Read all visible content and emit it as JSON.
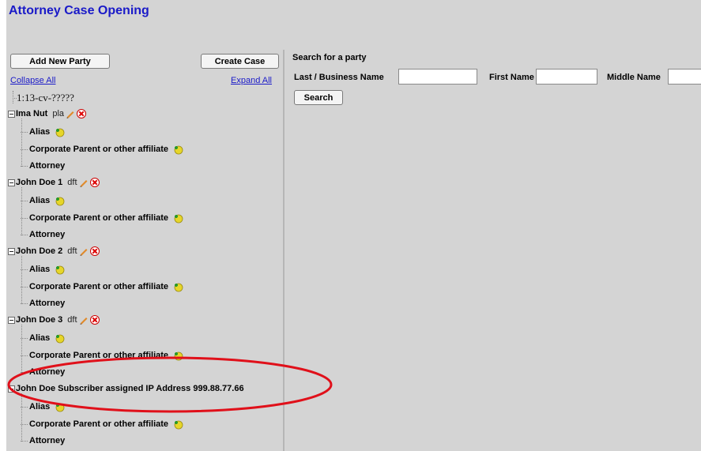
{
  "page": {
    "title": "Attorney Case Opening"
  },
  "toolbar": {
    "add_party_label": "Add New Party",
    "create_case_label": "Create Case",
    "collapse_label": "Collapse All",
    "expand_label": "Expand All"
  },
  "tree": {
    "case_number": "1:13-cv-?????",
    "parties": [
      {
        "name": "Ima Nut",
        "role": "pla",
        "children": [
          "Alias",
          "Corporate Parent or other affiliate",
          "Attorney"
        ]
      },
      {
        "name": "John Doe 1",
        "role": "dft",
        "children": [
          "Alias",
          "Corporate Parent or other affiliate",
          "Attorney"
        ]
      },
      {
        "name": "John Doe 2",
        "role": "dft",
        "children": [
          "Alias",
          "Corporate Parent or other affiliate",
          "Attorney"
        ]
      },
      {
        "name": "John Doe 3",
        "role": "dft",
        "children": [
          "Alias",
          "Corporate Parent or other affiliate",
          "Attorney"
        ]
      },
      {
        "name": "John Doe Subscriber assigned IP Address 999.88.77.66",
        "role": "",
        "children": [
          "Alias",
          "Corporate Parent or other affiliate",
          "Attorney"
        ]
      }
    ]
  },
  "search_panel": {
    "title": "Search for a party",
    "last_label": "Last / Business Name",
    "last_value": "",
    "first_label": "First Name",
    "first_value": "",
    "middle_label": "Middle Name",
    "middle_value": "",
    "search_label": "Search"
  },
  "colors": {
    "title": "#1a1ac8",
    "link": "#1a1ac8",
    "background": "#d4d4d4",
    "annotation": "#e0101a"
  },
  "icons": {
    "edit": "pencil-icon",
    "delete": "delete-x-icon",
    "add": "add-plus-icon"
  }
}
